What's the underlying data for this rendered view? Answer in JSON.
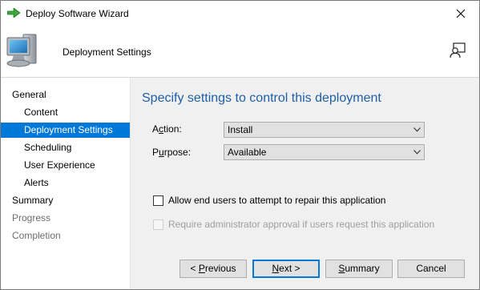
{
  "window": {
    "title": "Deploy Software Wizard",
    "close_glyph": "✕"
  },
  "header": {
    "title": "Deployment Settings",
    "icon": "computer-icon",
    "help_icon": "help-icon"
  },
  "nav": {
    "items": [
      {
        "label": "General",
        "state": "normal",
        "indent": 0
      },
      {
        "label": "Content",
        "state": "normal",
        "indent": 1
      },
      {
        "label": "Deployment Settings",
        "state": "selected",
        "indent": 1
      },
      {
        "label": "Scheduling",
        "state": "normal",
        "indent": 1
      },
      {
        "label": "User Experience",
        "state": "normal",
        "indent": 1
      },
      {
        "label": "Alerts",
        "state": "normal",
        "indent": 1
      },
      {
        "label": "Summary",
        "state": "normal",
        "indent": 0
      },
      {
        "label": "Progress",
        "state": "disabled",
        "indent": 0
      },
      {
        "label": "Completion",
        "state": "disabled",
        "indent": 0
      }
    ]
  },
  "main": {
    "heading": "Specify settings to control this deployment",
    "action": {
      "label_pre": "A",
      "label_key": "c",
      "label_post": "tion:",
      "value": "Install"
    },
    "purpose": {
      "label_pre": "P",
      "label_key": "u",
      "label_post": "rpose:",
      "value": "Available"
    },
    "repair_checkbox": {
      "label": "Allow end users to attempt to repair this application",
      "checked": false,
      "enabled": true
    },
    "approval_checkbox": {
      "label": "Require administrator approval if users request this application",
      "checked": false,
      "enabled": false
    }
  },
  "buttons": {
    "previous": {
      "pre": "< ",
      "key": "P",
      "post": "revious"
    },
    "next": {
      "pre": "",
      "key": "N",
      "post": "ext >"
    },
    "summary": {
      "pre": "",
      "key": "S",
      "post": "ummary"
    },
    "cancel": {
      "label": "Cancel"
    }
  },
  "colors": {
    "accent": "#0078d7",
    "heading": "#1e5fa8",
    "main_bg": "#f0f0f0"
  }
}
